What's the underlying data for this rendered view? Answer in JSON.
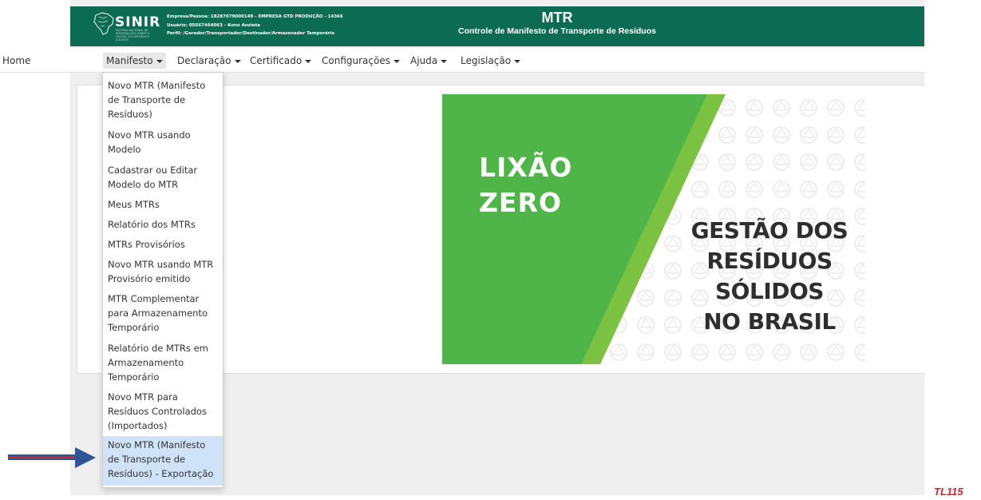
{
  "header": {
    "brand": "SINIR",
    "brand_subtitle": "SISTEMA NACIONAL DE INFORMAÇÕES SOBRE A GESTÃO DOS RESÍDUOS SÓLIDOS",
    "company_line": "Empresa/Pessoa: 18287079000149 - EMPRESA GTD PRODUÇÃO - 14366",
    "user_line": "Usuário: 05667464063 - Kono Anzieta",
    "profile_line": "Perfil: /Gerador/Transportador/Destinador/Armazenador Temporário",
    "title": "MTR",
    "subtitle": "Controle de Manifesto de Transporte de Resíduos",
    "bg_color": "#0b6b53"
  },
  "menubar": {
    "home": "Home",
    "manifesto": "Manifesto",
    "declaracao": "Declaração",
    "certificado": "Certificado",
    "configuracoes": "Configurações",
    "ajuda": "Ajuda",
    "legislacao": "Legislação"
  },
  "dropdown_items": [
    "Novo MTR (Manifesto\nde Transporte de\nResíduos)",
    "Novo MTR usando\nModelo",
    "Cadastrar ou Editar\nModelo do MTR",
    "Meus MTRs",
    "Relatório dos MTRs",
    "MTRs Provisórios",
    "Novo MTR usando MTR\nProvisório emitido",
    "MTR Complementar\npara Armazenamento\nTemporário",
    "Relatório de MTRs em\nArmazenamento\nTemporário",
    "Novo MTR para\nResíduos Controlados\n(Importados)",
    "Novo MTR (Manifesto\nde Transporte de\nResíduos) - Exportação"
  ],
  "banner": {
    "lixao_line1": "LIXÃO",
    "lixao_line2": "ZERO",
    "gestao_line1": "GESTÃO DOS",
    "gestao_line2": "RESÍDUOS",
    "gestao_line3": "SÓLIDOS",
    "gestao_line4": "NO BRASIL",
    "green": "#4fb548",
    "green_light": "#7cc242"
  },
  "arrow_color": "#2f5597",
  "slide_tag": "TL115"
}
